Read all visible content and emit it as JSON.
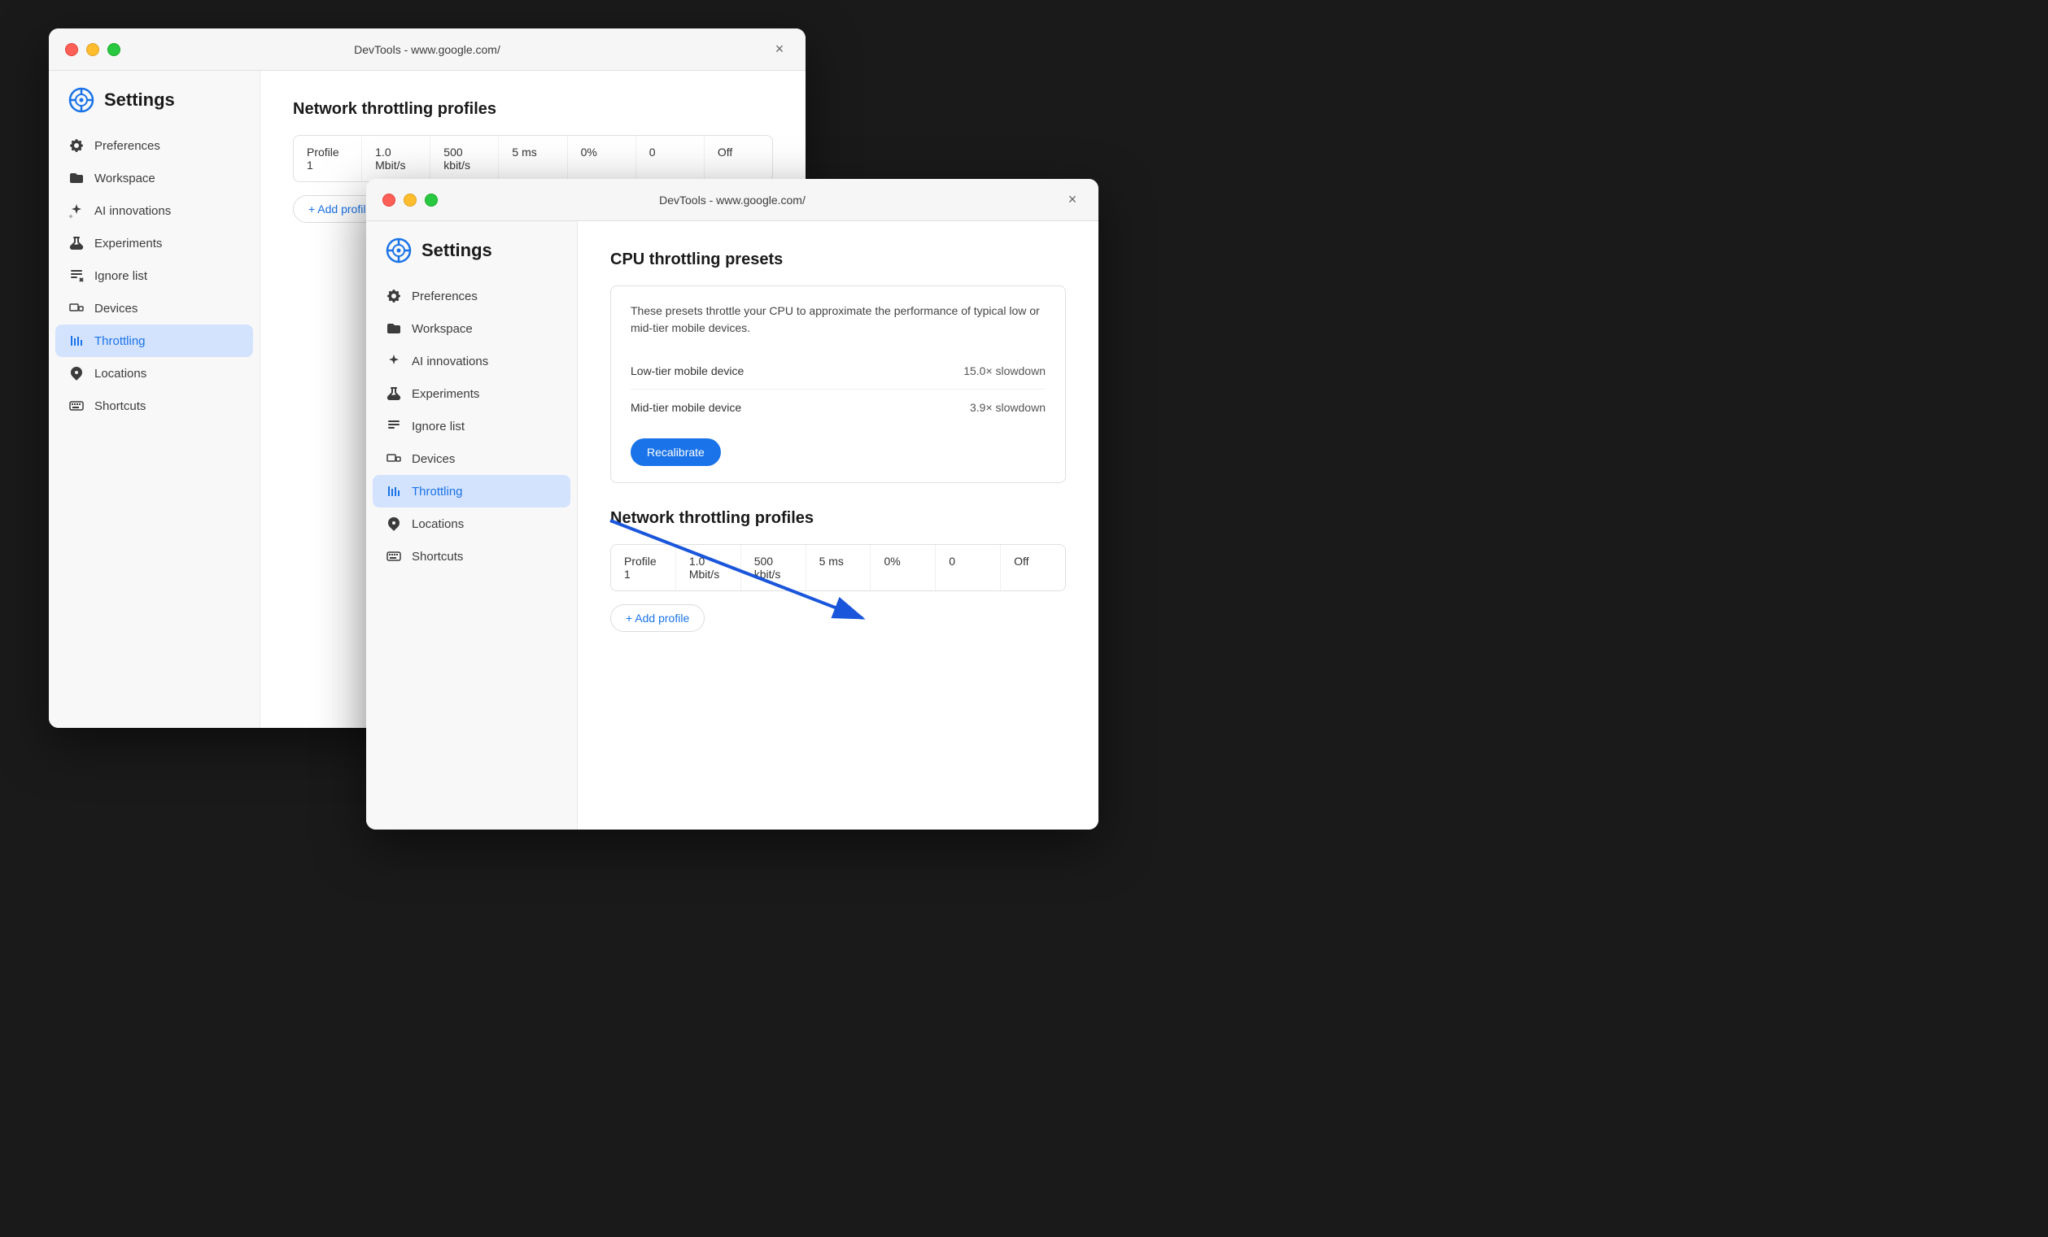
{
  "window1": {
    "title": "DevTools - www.google.com/",
    "close_label": "×",
    "settings": {
      "title": "Settings",
      "sidebar_items": [
        {
          "id": "preferences",
          "label": "Preferences",
          "icon": "gear"
        },
        {
          "id": "workspace",
          "label": "Workspace",
          "icon": "folder"
        },
        {
          "id": "ai-innovations",
          "label": "AI innovations",
          "icon": "sparkle"
        },
        {
          "id": "experiments",
          "label": "Experiments",
          "icon": "flask"
        },
        {
          "id": "ignore-list",
          "label": "Ignore list",
          "icon": "ignore"
        },
        {
          "id": "devices",
          "label": "Devices",
          "icon": "devices"
        },
        {
          "id": "throttling",
          "label": "Throttling",
          "icon": "throttle",
          "active": true
        },
        {
          "id": "locations",
          "label": "Locations",
          "icon": "pin"
        },
        {
          "id": "shortcuts",
          "label": "Shortcuts",
          "icon": "keyboard"
        }
      ]
    },
    "main": {
      "network_section_title": "Network throttling profiles",
      "network_table": {
        "columns": [
          "Profile 1",
          "1.0 Mbit/s",
          "500 kbit/s",
          "5 ms",
          "0%",
          "0",
          "Off"
        ]
      },
      "add_profile_label": "+ Add profile"
    }
  },
  "window2": {
    "title": "DevTools - www.google.com/",
    "close_label": "×",
    "settings": {
      "title": "Settings",
      "sidebar_items": [
        {
          "id": "preferences",
          "label": "Preferences",
          "icon": "gear"
        },
        {
          "id": "workspace",
          "label": "Workspace",
          "icon": "folder"
        },
        {
          "id": "ai-innovations",
          "label": "AI innovations",
          "icon": "sparkle"
        },
        {
          "id": "experiments",
          "label": "Experiments",
          "icon": "flask"
        },
        {
          "id": "ignore-list",
          "label": "Ignore list",
          "icon": "ignore"
        },
        {
          "id": "devices",
          "label": "Devices",
          "icon": "devices"
        },
        {
          "id": "throttling",
          "label": "Throttling",
          "icon": "throttle",
          "active": true
        },
        {
          "id": "locations",
          "label": "Locations",
          "icon": "pin"
        },
        {
          "id": "shortcuts",
          "label": "Shortcuts",
          "icon": "keyboard"
        }
      ]
    },
    "main": {
      "cpu_section_title": "CPU throttling presets",
      "cpu_description": "These presets throttle your CPU to approximate the performance of typical low or mid-tier mobile devices.",
      "cpu_presets": [
        {
          "label": "Low-tier mobile device",
          "value": "15.0× slowdown"
        },
        {
          "label": "Mid-tier mobile device",
          "value": "3.9× slowdown"
        }
      ],
      "recalibrate_label": "Recalibrate",
      "network_section_title": "Network throttling profiles",
      "network_table": {
        "columns": [
          "Profile 1",
          "1.0 Mbit/s",
          "500 kbit/s",
          "5 ms",
          "0%",
          "0",
          "Off"
        ]
      },
      "add_profile_label": "+ Add profile"
    }
  }
}
